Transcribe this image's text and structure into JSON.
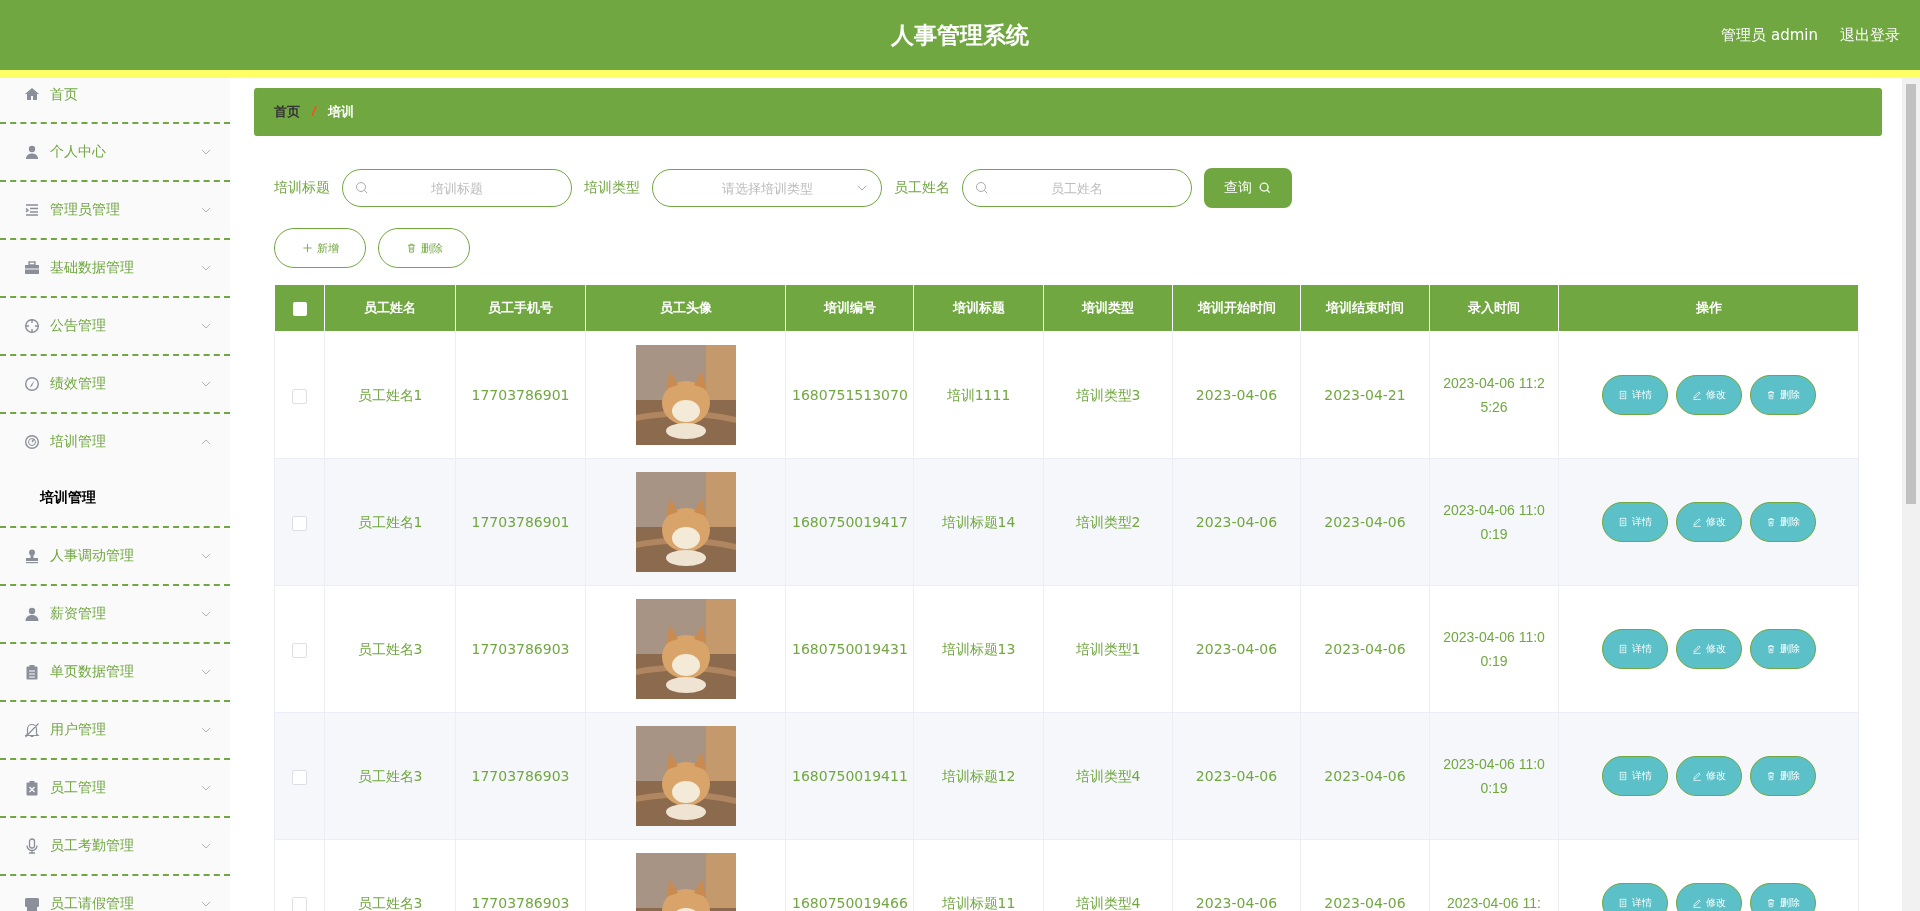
{
  "header": {
    "title": "人事管理系统",
    "user": "管理员 admin",
    "logout": "退出登录"
  },
  "sidebar": {
    "items": [
      {
        "label": "首页",
        "has_arrow": false
      },
      {
        "label": "个人中心",
        "has_arrow": true,
        "expanded": false
      },
      {
        "label": "管理员管理",
        "has_arrow": true,
        "expanded": false
      },
      {
        "label": "基础数据管理",
        "has_arrow": true,
        "expanded": false
      },
      {
        "label": "公告管理",
        "has_arrow": true,
        "expanded": false
      },
      {
        "label": "绩效管理",
        "has_arrow": true,
        "expanded": false
      },
      {
        "label": "培训管理",
        "has_arrow": true,
        "expanded": true,
        "children": [
          {
            "label": "培训管理",
            "selected": true
          }
        ]
      },
      {
        "label": "人事调动管理",
        "has_arrow": true,
        "expanded": false
      },
      {
        "label": "薪资管理",
        "has_arrow": true,
        "expanded": false
      },
      {
        "label": "单页数据管理",
        "has_arrow": true,
        "expanded": false
      },
      {
        "label": "用户管理",
        "has_arrow": true,
        "expanded": false
      },
      {
        "label": "员工管理",
        "has_arrow": true,
        "expanded": false
      },
      {
        "label": "员工考勤管理",
        "has_arrow": true,
        "expanded": false
      },
      {
        "label": "员工请假管理",
        "has_arrow": true,
        "expanded": false
      }
    ]
  },
  "breadcrumb": [
    "首页",
    "培训"
  ],
  "filters": [
    {
      "kind": "search",
      "label": "培训标题",
      "placeholder": "培训标题"
    },
    {
      "kind": "select",
      "label": "培训类型",
      "placeholder": "请选择培训类型"
    },
    {
      "kind": "search",
      "label": "员工姓名",
      "placeholder": "员工姓名"
    }
  ],
  "query_button": "查询",
  "actions": [
    {
      "kind": "add",
      "label": "新增"
    },
    {
      "kind": "delete",
      "label": "删除"
    }
  ],
  "table": {
    "select_all": {
      "checked": false
    },
    "columns": [
      "员工姓名",
      "员工手机号",
      "员工头像",
      "培训编号",
      "培训标题",
      "培训类型",
      "培训开始时间",
      "培训结束时间",
      "录入时间",
      "操作"
    ],
    "rows": [
      {
        "checked": false,
        "cells": [
          "员工姓名1",
          "17703786901",
          {
            "kind": "picture"
          },
          "1680751513070",
          "培训1111",
          "培训类型3",
          "2023-04-06",
          "2023-04-21",
          "2023-04-06 11:25:26"
        ],
        "buttons": [
          {
            "kind": "detail",
            "label": "详情"
          },
          {
            "kind": "edit",
            "label": "修改"
          },
          {
            "kind": "delete",
            "label": "删除"
          }
        ]
      },
      {
        "checked": false,
        "cells": [
          "员工姓名1",
          "17703786901",
          {
            "kind": "picture"
          },
          "1680750019417",
          "培训标题14",
          "培训类型2",
          "2023-04-06",
          "2023-04-06",
          "2023-04-06 11:00:19"
        ],
        "buttons": [
          {
            "kind": "detail",
            "label": "详情"
          },
          {
            "kind": "edit",
            "label": "修改"
          },
          {
            "kind": "delete",
            "label": "删除"
          }
        ]
      },
      {
        "checked": false,
        "cells": [
          "员工姓名3",
          "17703786903",
          {
            "kind": "picture"
          },
          "1680750019431",
          "培训标题13",
          "培训类型1",
          "2023-04-06",
          "2023-04-06",
          "2023-04-06 11:00:19"
        ],
        "buttons": [
          {
            "kind": "detail",
            "label": "详情"
          },
          {
            "kind": "edit",
            "label": "修改"
          },
          {
            "kind": "delete",
            "label": "删除"
          }
        ]
      },
      {
        "checked": false,
        "cells": [
          "员工姓名3",
          "17703786903",
          {
            "kind": "picture"
          },
          "1680750019411",
          "培训标题12",
          "培训类型4",
          "2023-04-06",
          "2023-04-06",
          "2023-04-06 11:00:19"
        ],
        "buttons": [
          {
            "kind": "detail",
            "label": "详情"
          },
          {
            "kind": "edit",
            "label": "修改"
          },
          {
            "kind": "delete",
            "label": "删除"
          }
        ]
      },
      {
        "checked": false,
        "cells": [
          "员工姓名3",
          "17703786903",
          {
            "kind": "picture"
          },
          "1680750019466",
          "培训标题11",
          "培训类型4",
          "2023-04-06",
          "2023-04-06",
          "2023-04-06 11:"
        ],
        "buttons": [
          {
            "kind": "detail",
            "label": "详情"
          },
          {
            "kind": "edit",
            "label": "修改"
          },
          {
            "kind": "delete",
            "label": "删除"
          }
        ]
      }
    ]
  }
}
